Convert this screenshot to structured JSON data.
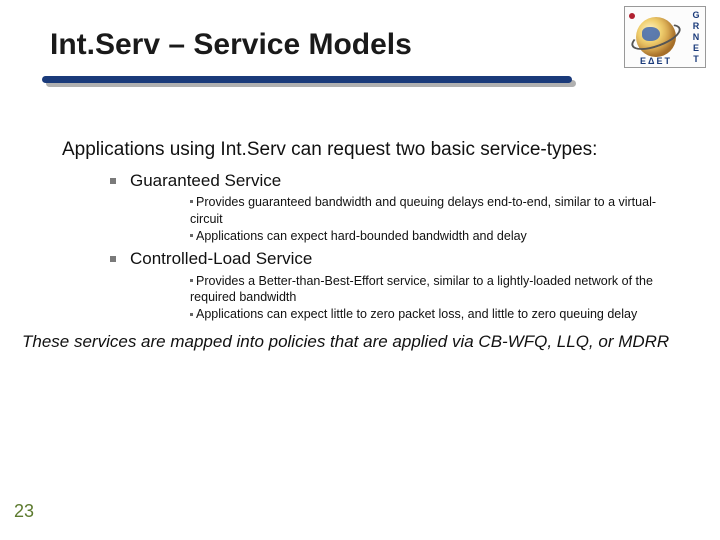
{
  "title": "Int.Serv – Service Models",
  "intro": "Applications using Int.Serv can request two basic service-types:",
  "services": [
    {
      "name": "Guaranteed Service",
      "points": [
        "Provides guaranteed bandwidth and queuing delays end-to-end, similar to a virtual-circuit",
        "Applications can expect hard-bounded bandwidth and delay"
      ]
    },
    {
      "name": "Controlled-Load Service",
      "points": [
        "Provides a Better-than-Best-Effort service, similar to a lightly-loaded network of the required bandwidth",
        "Applications can expect little to zero packet loss, and little to zero queuing delay"
      ]
    }
  ],
  "closing": "These services are mapped into policies that are applied via CB-WFQ, LLQ, or MDRR",
  "page_number": "23",
  "logo": {
    "right_letters": [
      "G",
      "R",
      "N",
      "E",
      "T"
    ],
    "bottom_text": "ΕΔΕΤ"
  }
}
